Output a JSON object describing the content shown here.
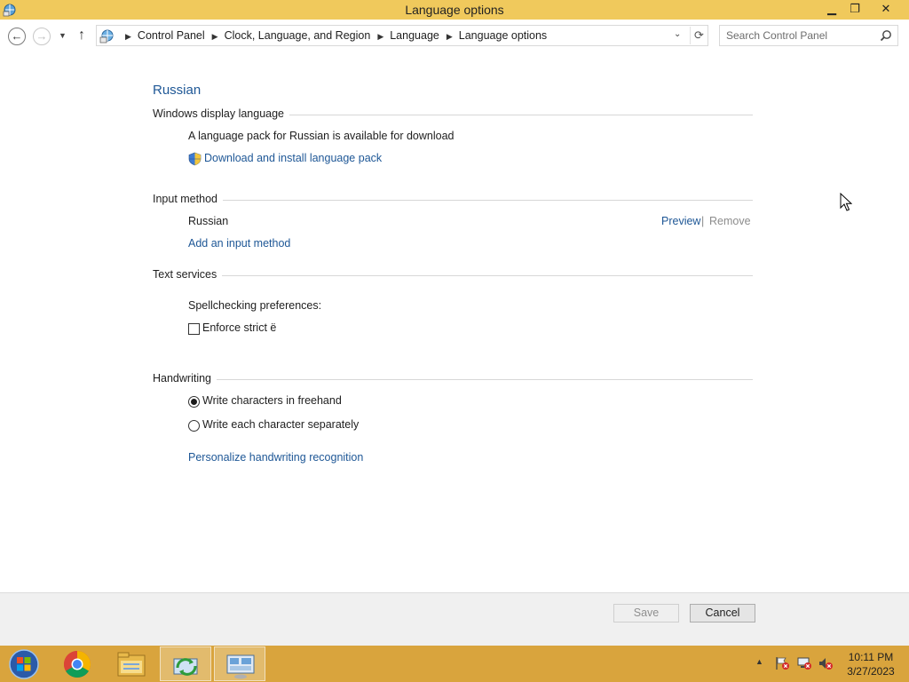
{
  "window": {
    "title": "Language options",
    "minimize_label": "▁",
    "maximize_label": "❐",
    "close_label": "✕"
  },
  "navigation": {
    "back_label": "←",
    "forward_label": "→",
    "recent_label": "▼",
    "up_label": "↑",
    "breadcrumbs": [
      "Control Panel",
      "Clock, Language, and Region",
      "Language",
      "Language options"
    ],
    "separator": "▶",
    "dropdown_label": "⌄",
    "refresh_label": "⟳",
    "search_placeholder": "Search Control Panel"
  },
  "content": {
    "language_name": "Russian",
    "display_language": {
      "heading": "Windows display language",
      "availability_text": "A language pack for Russian is available for download",
      "download_link": "Download and install language pack"
    },
    "input_method": {
      "heading": "Input method",
      "method_name": "Russian",
      "preview_link": "Preview",
      "pipe": "|",
      "remove_link": "Remove",
      "add_link": "Add an input method"
    },
    "text_services": {
      "heading": "Text services",
      "spellcheck_label": "Spellchecking preferences:",
      "enforce_label": "Enforce strict ё",
      "enforce_checked": false
    },
    "handwriting": {
      "heading": "Handwriting",
      "option_freehand": "Write characters in freehand",
      "option_separate": "Write each character separately",
      "selected": "freehand",
      "personalize_link": "Personalize handwriting recognition"
    }
  },
  "footer": {
    "save_label": "Save",
    "cancel_label": "Cancel"
  },
  "taskbar": {
    "apps": [
      "start-orb",
      "chrome",
      "file-explorer",
      "network-sync",
      "control-panel"
    ],
    "active_app": "control-panel",
    "tray_up_label": "▲",
    "time": "10:11 PM",
    "date": "3/27/2023"
  },
  "colors": {
    "title_bar": "#f0c95c",
    "taskbar": "#d9a43d",
    "link": "#1e5796",
    "heading": "#1e5796"
  }
}
